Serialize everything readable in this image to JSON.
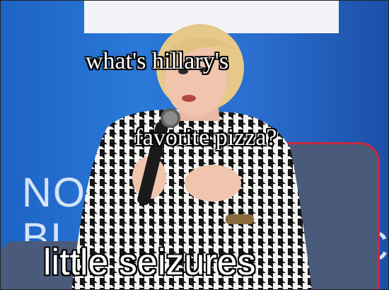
{
  "meme": {
    "top_caption_line1": "what's hillary's",
    "top_caption_line2": "favorite pizza?",
    "bottom_caption": "little seizures"
  },
  "backdrop": {
    "lettering_left": "NO\nBL",
    "lettering_right": "HC"
  },
  "colors": {
    "backdrop_blue": "#2a78d8",
    "caption_fill": "#ffffff",
    "caption_outline": "#000000",
    "chair_trim": "#c9283e"
  },
  "icons": {
    "microphone": "microphone-icon"
  }
}
